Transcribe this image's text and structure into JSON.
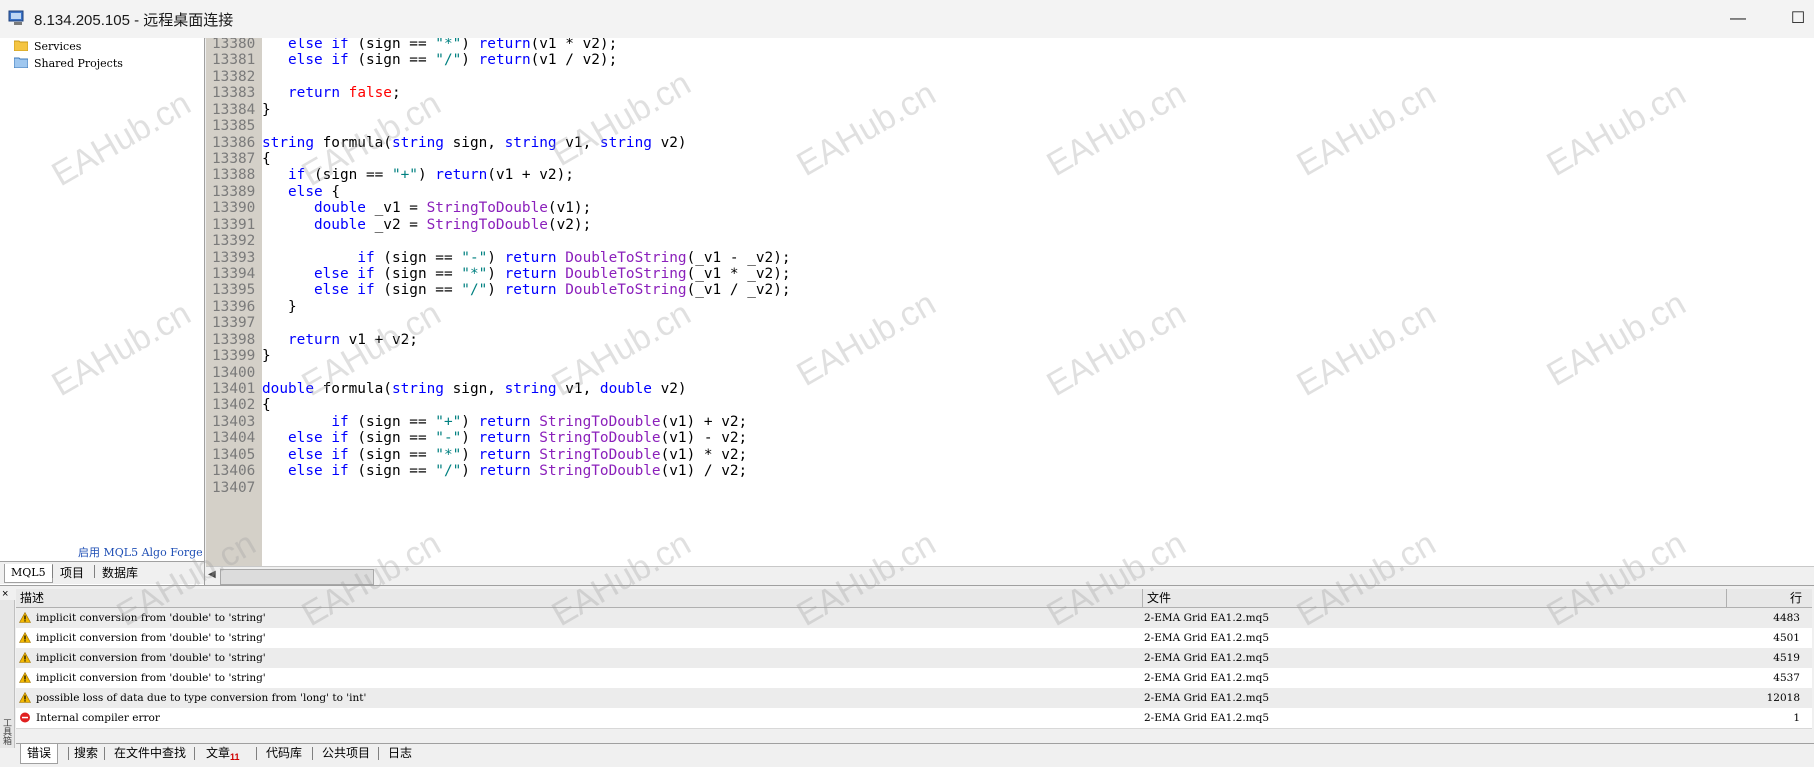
{
  "window": {
    "title": "8.134.205.105 - 远程桌面连接",
    "minimize": "—",
    "maximize": "☐"
  },
  "navigator": {
    "items": [
      {
        "label": "Services",
        "icon": "folder-icon"
      },
      {
        "label": "Shared Projects",
        "icon": "shared-folder-icon"
      }
    ],
    "algo_forge_link": "启用 MQL5 Algo Forge",
    "tabs": [
      "MQL5",
      "项目",
      "数据库"
    ]
  },
  "editor": {
    "lines": [
      {
        "n": "13380",
        "code": [
          [
            "   ",
            ""
          ],
          [
            "else if",
            "kw"
          ],
          [
            " (sign == ",
            ""
          ],
          [
            "\"*\"",
            "str"
          ],
          [
            ") ",
            ""
          ],
          [
            "return",
            "kw"
          ],
          [
            "(v1 * v2);",
            ""
          ]
        ]
      },
      {
        "n": "13381",
        "code": [
          [
            "   ",
            ""
          ],
          [
            "else if",
            "kw"
          ],
          [
            " (sign == ",
            ""
          ],
          [
            "\"/\"",
            "str"
          ],
          [
            ") ",
            ""
          ],
          [
            "return",
            "kw"
          ],
          [
            "(v1 / v2);",
            ""
          ]
        ]
      },
      {
        "n": "13382",
        "code": []
      },
      {
        "n": "13383",
        "code": [
          [
            "   ",
            ""
          ],
          [
            "return",
            "kw"
          ],
          [
            " ",
            ""
          ],
          [
            "false",
            "bool"
          ],
          [
            ";",
            ""
          ]
        ]
      },
      {
        "n": "13384",
        "code": [
          [
            "}",
            ""
          ]
        ]
      },
      {
        "n": "13385",
        "code": []
      },
      {
        "n": "13386",
        "code": [
          [
            "string",
            "kw"
          ],
          [
            " formula(",
            ""
          ],
          [
            "string",
            "kw"
          ],
          [
            " sign, ",
            ""
          ],
          [
            "string",
            "kw"
          ],
          [
            " v1, ",
            ""
          ],
          [
            "string",
            "kw"
          ],
          [
            " v2)",
            ""
          ]
        ]
      },
      {
        "n": "13387",
        "code": [
          [
            "{",
            ""
          ]
        ]
      },
      {
        "n": "13388",
        "code": [
          [
            "   ",
            ""
          ],
          [
            "if",
            "kw"
          ],
          [
            " (sign == ",
            ""
          ],
          [
            "\"+\"",
            "str"
          ],
          [
            ") ",
            ""
          ],
          [
            "return",
            "kw"
          ],
          [
            "(v1 + v2);",
            ""
          ]
        ]
      },
      {
        "n": "13389",
        "code": [
          [
            "   ",
            ""
          ],
          [
            "else",
            "kw"
          ],
          [
            " {",
            ""
          ]
        ]
      },
      {
        "n": "13390",
        "code": [
          [
            "      ",
            ""
          ],
          [
            "double",
            "kw"
          ],
          [
            " _v1 = ",
            ""
          ],
          [
            "StringToDouble",
            "fn"
          ],
          [
            "(v1);",
            ""
          ]
        ]
      },
      {
        "n": "13391",
        "code": [
          [
            "      ",
            ""
          ],
          [
            "double",
            "kw"
          ],
          [
            " _v2 = ",
            ""
          ],
          [
            "StringToDouble",
            "fn"
          ],
          [
            "(v2);",
            ""
          ]
        ]
      },
      {
        "n": "13392",
        "code": []
      },
      {
        "n": "13393",
        "code": [
          [
            "           ",
            ""
          ],
          [
            "if",
            "kw"
          ],
          [
            " (sign == ",
            ""
          ],
          [
            "\"-\"",
            "str"
          ],
          [
            ") ",
            ""
          ],
          [
            "return",
            "kw"
          ],
          [
            " ",
            ""
          ],
          [
            "DoubleToString",
            "fn"
          ],
          [
            "(_v1 - _v2);",
            ""
          ]
        ]
      },
      {
        "n": "13394",
        "code": [
          [
            "      ",
            ""
          ],
          [
            "else if",
            "kw"
          ],
          [
            " (sign == ",
            ""
          ],
          [
            "\"*\"",
            "str"
          ],
          [
            ") ",
            ""
          ],
          [
            "return",
            "kw"
          ],
          [
            " ",
            ""
          ],
          [
            "DoubleToString",
            "fn"
          ],
          [
            "(_v1 * _v2);",
            ""
          ]
        ]
      },
      {
        "n": "13395",
        "code": [
          [
            "      ",
            ""
          ],
          [
            "else if",
            "kw"
          ],
          [
            " (sign == ",
            ""
          ],
          [
            "\"/\"",
            "str"
          ],
          [
            ") ",
            ""
          ],
          [
            "return",
            "kw"
          ],
          [
            " ",
            ""
          ],
          [
            "DoubleToString",
            "fn"
          ],
          [
            "(_v1 / _v2);",
            ""
          ]
        ]
      },
      {
        "n": "13396",
        "code": [
          [
            "   }",
            ""
          ]
        ]
      },
      {
        "n": "13397",
        "code": []
      },
      {
        "n": "13398",
        "code": [
          [
            "   ",
            ""
          ],
          [
            "return",
            "kw"
          ],
          [
            " v1 + v2;",
            ""
          ]
        ]
      },
      {
        "n": "13399",
        "code": [
          [
            "}",
            ""
          ]
        ]
      },
      {
        "n": "13400",
        "code": []
      },
      {
        "n": "13401",
        "code": [
          [
            "double",
            "kw"
          ],
          [
            " formula(",
            ""
          ],
          [
            "string",
            "kw"
          ],
          [
            " sign, ",
            ""
          ],
          [
            "string",
            "kw"
          ],
          [
            " v1, ",
            ""
          ],
          [
            "double",
            "kw"
          ],
          [
            " v2)",
            ""
          ]
        ]
      },
      {
        "n": "13402",
        "code": [
          [
            "{",
            ""
          ]
        ]
      },
      {
        "n": "13403",
        "code": [
          [
            "        ",
            ""
          ],
          [
            "if",
            "kw"
          ],
          [
            " (sign == ",
            ""
          ],
          [
            "\"+\"",
            "str"
          ],
          [
            ") ",
            ""
          ],
          [
            "return",
            "kw"
          ],
          [
            " ",
            ""
          ],
          [
            "StringToDouble",
            "fn"
          ],
          [
            "(v1) + v2;",
            ""
          ]
        ]
      },
      {
        "n": "13404",
        "code": [
          [
            "   ",
            ""
          ],
          [
            "else if",
            "kw"
          ],
          [
            " (sign == ",
            ""
          ],
          [
            "\"-\"",
            "str"
          ],
          [
            ") ",
            ""
          ],
          [
            "return",
            "kw"
          ],
          [
            " ",
            ""
          ],
          [
            "StringToDouble",
            "fn"
          ],
          [
            "(v1) - v2;",
            ""
          ]
        ]
      },
      {
        "n": "13405",
        "code": [
          [
            "   ",
            ""
          ],
          [
            "else if",
            "kw"
          ],
          [
            " (sign == ",
            ""
          ],
          [
            "\"*\"",
            "str"
          ],
          [
            ") ",
            ""
          ],
          [
            "return",
            "kw"
          ],
          [
            " ",
            ""
          ],
          [
            "StringToDouble",
            "fn"
          ],
          [
            "(v1) * v2;",
            ""
          ]
        ]
      },
      {
        "n": "13406",
        "code": [
          [
            "   ",
            ""
          ],
          [
            "else if",
            "kw"
          ],
          [
            " (sign == ",
            ""
          ],
          [
            "\"/\"",
            "str"
          ],
          [
            ") ",
            ""
          ],
          [
            "return",
            "kw"
          ],
          [
            " ",
            ""
          ],
          [
            "StringToDouble",
            "fn"
          ],
          [
            "(v1) / v2;",
            ""
          ]
        ]
      },
      {
        "n": "13407",
        "code": []
      }
    ]
  },
  "toolbox": {
    "close": "×",
    "columns": {
      "desc": "描述",
      "file": "文件",
      "line": "行"
    },
    "rows": [
      {
        "type": "warning",
        "desc": "implicit conversion from 'double' to 'string'",
        "file": "2-EMA Grid EA1.2.mq5",
        "line": "4483"
      },
      {
        "type": "warning",
        "desc": "implicit conversion from 'double' to 'string'",
        "file": "2-EMA Grid EA1.2.mq5",
        "line": "4501"
      },
      {
        "type": "warning",
        "desc": "implicit conversion from 'double' to 'string'",
        "file": "2-EMA Grid EA1.2.mq5",
        "line": "4519"
      },
      {
        "type": "warning",
        "desc": "implicit conversion from 'double' to 'string'",
        "file": "2-EMA Grid EA1.2.mq5",
        "line": "4537"
      },
      {
        "type": "warning",
        "desc": "possible loss of data due to type conversion from 'long' to 'int'",
        "file": "2-EMA Grid EA1.2.mq5",
        "line": "12018"
      },
      {
        "type": "error",
        "desc": "Internal compiler error",
        "file": "2-EMA Grid EA1.2.mq5",
        "line": "1"
      }
    ],
    "tabs": [
      "错误",
      "搜索",
      "在文件中查找",
      "文章",
      "代码库",
      "公共项目",
      "日志"
    ],
    "articles_badge": "11",
    "side_label": "工具箱"
  },
  "watermark": "EAHub.cn",
  "colors": {
    "keyword": "#0000ff",
    "string": "#008080",
    "function": "#8b20bb",
    "boolean": "#ff0000",
    "warning": "#f2b700",
    "error": "#e02020"
  }
}
